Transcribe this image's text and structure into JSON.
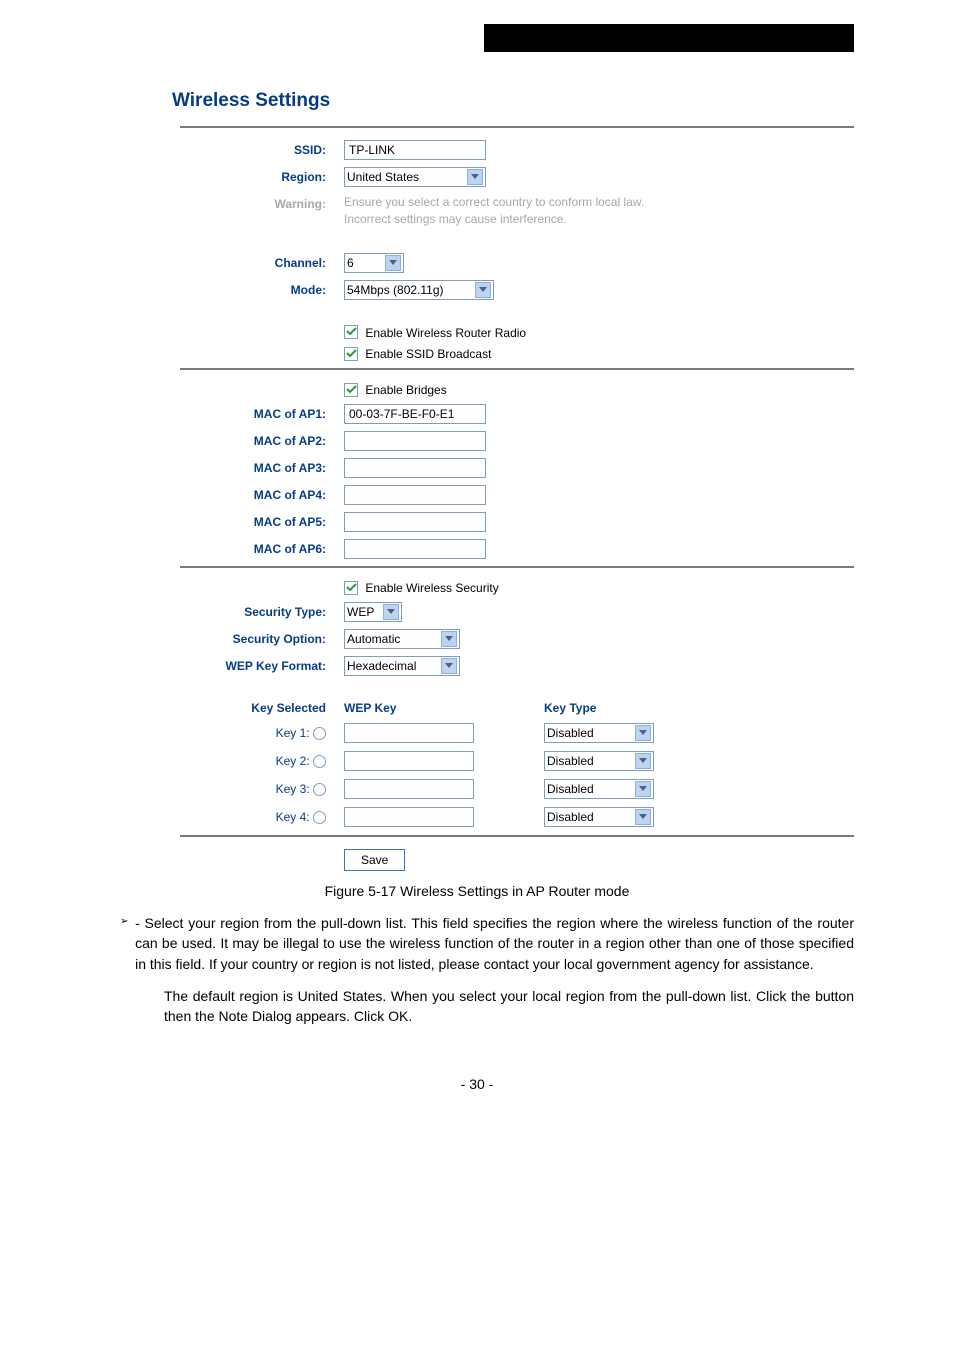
{
  "panel_title": "Wireless Settings",
  "rows": {
    "ssid": {
      "label": "SSID:",
      "value": "TP-LINK"
    },
    "region": {
      "label": "Region:",
      "value": "United States"
    },
    "warning": {
      "label": "Warning:",
      "line1": "Ensure you select a correct country to conform local law.",
      "line2": "Incorrect settings may cause interference."
    },
    "channel": {
      "label": "Channel:",
      "value": "6"
    },
    "mode": {
      "label": "Mode:",
      "value": "54Mbps (802.11g)"
    }
  },
  "checkboxes": {
    "radio": "Enable Wireless Router Radio",
    "ssid_bc": "Enable SSID Broadcast",
    "bridges": "Enable Bridges",
    "security": "Enable Wireless Security"
  },
  "mac": {
    "ap1": {
      "label": "MAC of AP1:",
      "value": "00-03-7F-BE-F0-E1"
    },
    "ap2": {
      "label": "MAC of AP2:",
      "value": ""
    },
    "ap3": {
      "label": "MAC of AP3:",
      "value": ""
    },
    "ap4": {
      "label": "MAC of AP4:",
      "value": ""
    },
    "ap5": {
      "label": "MAC of AP5:",
      "value": ""
    },
    "ap6": {
      "label": "MAC of AP6:",
      "value": ""
    }
  },
  "security": {
    "type": {
      "label": "Security Type:",
      "value": "WEP"
    },
    "option": {
      "label": "Security Option:",
      "value": "Automatic"
    },
    "format": {
      "label": "WEP Key Format:",
      "value": "Hexadecimal"
    }
  },
  "key_headers": {
    "selected": "Key Selected",
    "wepkey": "WEP Key",
    "type": "Key Type"
  },
  "keys": {
    "k1": {
      "label": "Key 1:",
      "type": "Disabled"
    },
    "k2": {
      "label": "Key 2:",
      "type": "Disabled"
    },
    "k3": {
      "label": "Key 3:",
      "type": "Disabled"
    },
    "k4": {
      "label": "Key 4:",
      "type": "Disabled"
    }
  },
  "save_btn": "Save",
  "caption": "Figure 5-17 Wireless Settings in AP Router mode",
  "bullet_text": "- Select your region from the pull-down list. This field specifies the region where the wireless function of the router can be used. It may be illegal to use the wireless function of the router in a region other than one of those specified in this field. If your country or region is not listed, please contact your local government agency for assistance.",
  "para2a": "The default region is United States. When you select your local region from the pull-down list. Click the ",
  "para2b": " button  then the Note Dialog appears. Click OK.",
  "page_num": "- 30 -"
}
